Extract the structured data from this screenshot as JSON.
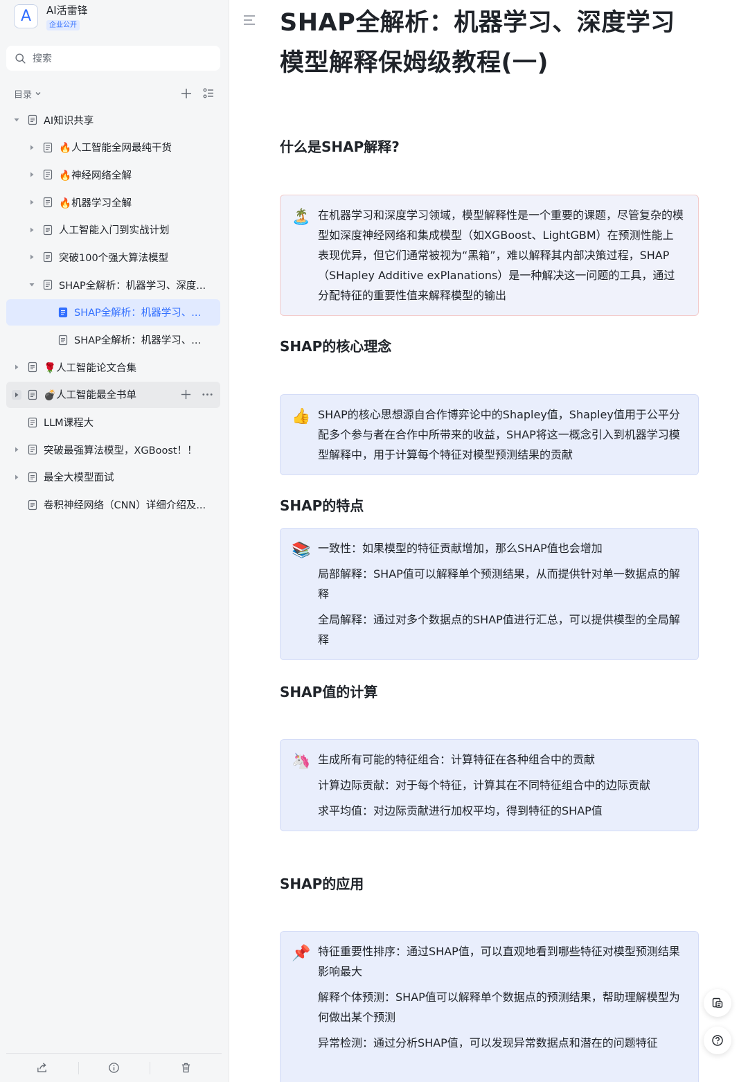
{
  "space": {
    "logo_letter": "A",
    "name": "AI活雷锋",
    "badge": "企业公开"
  },
  "search": {
    "label": "搜索"
  },
  "toc": {
    "label": "目录"
  },
  "tree": [
    {
      "emoji": "",
      "label": "AI知识共享"
    },
    {
      "emoji": "🔥",
      "label": "人工智能全网最纯干货"
    },
    {
      "emoji": "🔥",
      "label": "神经网络全解"
    },
    {
      "emoji": "🔥",
      "label": "机器学习全解"
    },
    {
      "emoji": "",
      "label": "人工智能入门到实战计划"
    },
    {
      "emoji": "",
      "label": "突破100个强大算法模型"
    },
    {
      "emoji": "",
      "label": "SHAP全解析：机器学习、深度..."
    },
    {
      "emoji": "",
      "label": "SHAP全解析：机器学习、..."
    },
    {
      "emoji": "",
      "label": "SHAP全解析：机器学习、..."
    },
    {
      "emoji": "🌹",
      "label": "人工智能论文合集"
    },
    {
      "emoji": "💣",
      "label": "人工智能最全书单"
    },
    {
      "emoji": "",
      "label": "LLM课程大"
    },
    {
      "emoji": "",
      "label": "突破最强算法模型，XGBoost！！"
    },
    {
      "emoji": "",
      "label": "最全大模型面试"
    },
    {
      "emoji": "",
      "label": "卷积神经网络（CNN）详细介绍及..."
    }
  ],
  "doc": {
    "title": "SHAP全解析：机器学习、深度学习模型解释保姆级教程(一)",
    "sections": [
      {
        "heading": "什么是SHAP解释?",
        "icon": "🏝️",
        "paragraphs": [
          "在机器学习和深度学习领域，模型解释性是一个重要的课题，尽管复杂的模型如深度神经网络和集成模型（如XGBoost、LightGBM）在预测性能上表现优异，但它们通常被视为“黑箱”，难以解释其内部决策过程，SHAP（SHapley Additive exPlanations）是一种解决这一问题的工具，通过分配特征的重要性值来解释模型的输出"
        ]
      },
      {
        "heading": "SHAP的核心理念",
        "icon": "👍",
        "paragraphs": [
          "SHAP的核心思想源自合作博弈论中的Shapley值，Shapley值用于公平分配多个参与者在合作中所带来的收益，SHAP将这一概念引入到机器学习模型解释中，用于计算每个特征对模型预测结果的贡献"
        ]
      },
      {
        "heading": "SHAP的特点",
        "icon": "📚",
        "paragraphs": [
          "一致性：如果模型的特征贡献增加，那么SHAP值也会增加",
          "局部解释：SHAP值可以解释单个预测结果，从而提供针对单一数据点的解释",
          "全局解释：通过对多个数据点的SHAP值进行汇总，可以提供模型的全局解释"
        ]
      },
      {
        "heading": "SHAP值的计算",
        "icon": "🦄",
        "paragraphs": [
          "生成所有可能的特征组合：计算特征在各种组合中的贡献",
          "计算边际贡献：对于每个特征，计算其在不同特征组合中的边际贡献",
          "求平均值：对边际贡献进行加权平均，得到特征的SHAP值"
        ]
      },
      {
        "heading": "SHAP的应用",
        "icon": "📌",
        "paragraphs": [
          "特征重要性排序：通过SHAP值，可以直观地看到哪些特征对模型预测结果影响最大",
          "解释个体预测：SHAP值可以解释单个数据点的预测结果，帮助理解模型为何做出某个预测",
          "异常检测：通过分析SHAP值，可以发现异常数据点和潜在的问题特征"
        ]
      }
    ]
  },
  "colors": {
    "accent": "#3370ff",
    "callout_bg": "#e9eefc",
    "sidebar_bg": "#f5f6f7"
  }
}
